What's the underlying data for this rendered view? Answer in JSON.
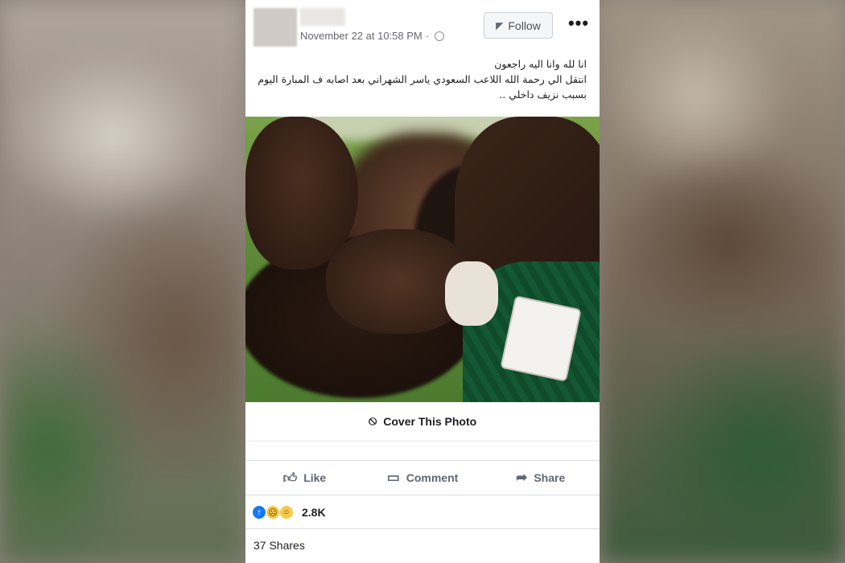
{
  "post": {
    "timestamp": "November 22 at 10:58 PM",
    "timestamp_separator": "·",
    "follow_label": "Follow",
    "more_label": "•••",
    "text_lines": [
      "انا لله وانا اليه راجعون",
      "انتقل الي رحمة الله اللاعب السعودي ياسر الشهراني بعد اصابه ف المبارة اليوم",
      "بسبب نزيف داخلي .."
    ],
    "cover_label": "Cover This Photo"
  },
  "actions": {
    "like": "Like",
    "comment": "Comment",
    "share": "Share"
  },
  "engagement": {
    "reaction_count": "2.8K",
    "shares": "37 Shares"
  },
  "icons": {
    "rss": "rss-icon",
    "globe": "globe-icon",
    "eye_slash": "eye-slash-icon",
    "like": "thumbs-up-icon",
    "comment": "comment-icon",
    "share": "share-icon"
  },
  "colors": {
    "like_blue": "#1877f2",
    "reaction_yellow": "#f7c94b",
    "text_secondary": "#606770"
  }
}
